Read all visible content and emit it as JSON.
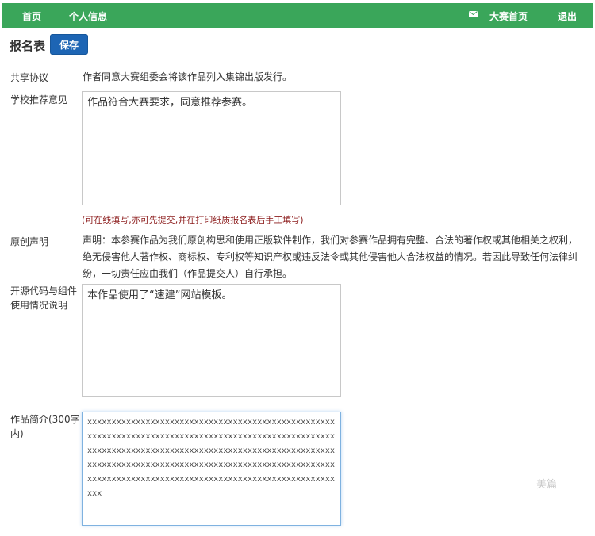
{
  "topbar": {
    "home": "首页",
    "profile": "个人信息",
    "contest_home": "大赛首页",
    "logout": "退出",
    "mail_icon": "envelope-icon"
  },
  "header": {
    "title": "报名表",
    "save_label": "保存"
  },
  "form": {
    "share_agreement": {
      "label": "共享协议",
      "value": "作者同意大赛组委会将该作品列入集锦出版发行。"
    },
    "school_recommendation": {
      "label": "学校推荐意见",
      "value": "作品符合大赛要求，同意推荐参赛。",
      "hint": "(可在线填写,亦可先提交,并在打印纸质报名表后手工填写)"
    },
    "originality": {
      "label": "原创声明",
      "value": "声明：本参赛作品为我们原创构思和使用正版软件制作，我们对参赛作品拥有完整、合法的著作权或其他相关之权利，绝无侵害他人著作权、商标权、专利权等知识产权或违反法令或其他侵害他人合法权益的情况。若因此导致任何法律纠纷，一切责任应由我们（作品提交人）自行承担。"
    },
    "open_source": {
      "label": "开源代码与组件使用情况说明",
      "value": "本作品使用了“速建”网站模板。"
    },
    "intro": {
      "label": "作品简介(300字内)",
      "value": "xxxxxxxxxxxxxxxxxxxxxxxxxxxxxxxxxxxxxxxxxxxxxxxxxxxxxxxxxxxxxxxxxxxxxxxxxxxxxxxxxxxxxxxxxxxxxxxxxxxxxxxxxxxxxxxxxxxxxxxxxxxxxxxxxxxxxxxxxxxxxxxxxxxxxxxxxxxxxxxxxxxxxxxxxxxxxxxxxxxxxxxxxxxxxxxxxxxxxxxxxxxxxxxxxxxxxxxxxxxxxxxxxxxxxxxxxxxxxxxxxxxxxxxxxxxxxxxxxx"
    }
  },
  "watermark": "美篇"
}
